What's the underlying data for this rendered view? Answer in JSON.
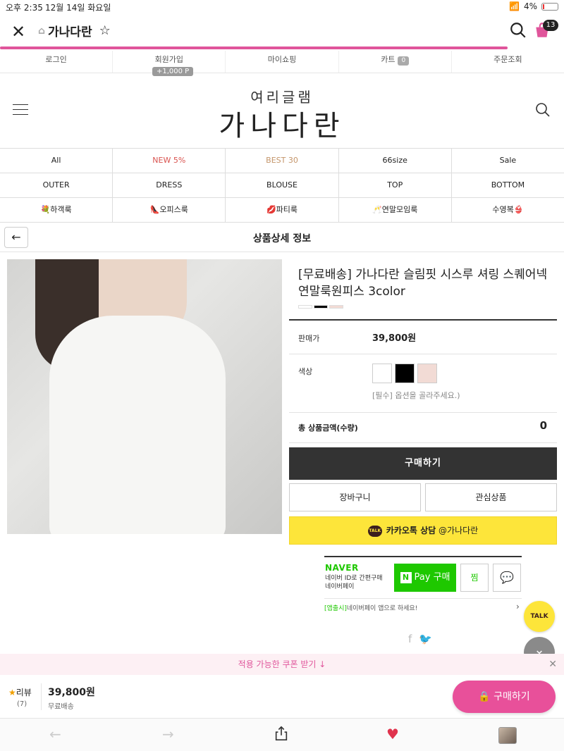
{
  "status_bar": {
    "time": "오후 2:35",
    "date": "12월 14일 화요일",
    "battery": "4%"
  },
  "browser": {
    "site_name": "가나다란",
    "cart_count": "13"
  },
  "top_menu": [
    {
      "label": "로그인"
    },
    {
      "label": "회원가입"
    },
    {
      "label": "마이쇼핑"
    },
    {
      "label": "카트",
      "count": "0"
    },
    {
      "label": "주문조회"
    }
  ],
  "signup_point": "+1,000 P",
  "logo": {
    "sub": "여리글램",
    "main": "가나다란"
  },
  "categories": {
    "row1": [
      "All",
      "NEW 5%",
      "BEST 30",
      "66size",
      "Sale"
    ],
    "row2": [
      "OUTER",
      "DRESS",
      "BLOUSE",
      "TOP",
      "BOTTOM"
    ],
    "row3": [
      "💐하객룩",
      "👠오피스룩",
      "💋파티룩",
      "🥂연말모임룩",
      "수영복👙"
    ]
  },
  "detail_header": {
    "title": "상품상세 정보"
  },
  "product": {
    "name": "[무료배송] 가나다란 슬림핏 시스루 셔링 스퀘어넥 연말룩원피스 3color",
    "price_label": "판매가",
    "price": "39,800원",
    "color_label": "색상",
    "option_note": "[필수] 옵션을 골라주세요.)",
    "total_label": "총 상품금액(수량)",
    "total_value": "0",
    "swatch_colors": [
      "#ffffff",
      "#000000",
      "#f2dbd5"
    ]
  },
  "buttons": {
    "buy": "구매하기",
    "cart": "장바구니",
    "wish": "관심상품",
    "kakao_bold": "카카오톡 상담",
    "kakao_rest": " @가나다란",
    "kakao_icon_text": "TALK"
  },
  "naver": {
    "logo": "NAVER",
    "desc": "네이버 ID로 간편구매 네이버페이",
    "pay_label": "Pay 구매",
    "zzim": "찜",
    "note_highlight": "[앱출시]",
    "note_rest": "네이버페이 앱으로 하세요!"
  },
  "floating": {
    "talk": "TALK"
  },
  "coupon": {
    "label": "적용 가능한 쿠폰 받기 ↓"
  },
  "bottom_bar": {
    "review_label": "리뷰",
    "review_count": "(7)",
    "price": "39,800원",
    "shipping": "무료배송",
    "buy": "구매하기"
  },
  "icons": {
    "close": "close-icon",
    "star": "star-icon",
    "search": "search-icon",
    "cart": "cart-icon",
    "back": "arrow-left-icon",
    "share": "share-icon",
    "heart": "heart-icon"
  }
}
